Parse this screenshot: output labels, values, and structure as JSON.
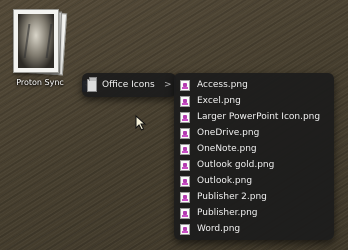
{
  "desktop": {
    "stack_label": "Proton Sync"
  },
  "menu": {
    "root_item": {
      "label": "Office Icons",
      "icon": "folder-icon",
      "chevron": ">"
    },
    "submenu_items": [
      {
        "label": "Access.png",
        "icon": "png-file-icon"
      },
      {
        "label": "Excel.png",
        "icon": "png-file-icon"
      },
      {
        "label": "Larger PowerPoint Icon.png",
        "icon": "png-file-icon"
      },
      {
        "label": "OneDrive.png",
        "icon": "png-file-icon"
      },
      {
        "label": "OneNote.png",
        "icon": "png-file-icon"
      },
      {
        "label": "Outlook gold.png",
        "icon": "png-file-icon"
      },
      {
        "label": "Outlook.png",
        "icon": "png-file-icon"
      },
      {
        "label": "Publisher 2.png",
        "icon": "png-file-icon"
      },
      {
        "label": "Publisher.png",
        "icon": "png-file-icon"
      },
      {
        "label": "Word.png",
        "icon": "png-file-icon"
      }
    ]
  },
  "colors": {
    "menu_bg": "#1c1c1c",
    "menu_text": "#f2f2f2",
    "desktop_bg": "#4a4232"
  }
}
